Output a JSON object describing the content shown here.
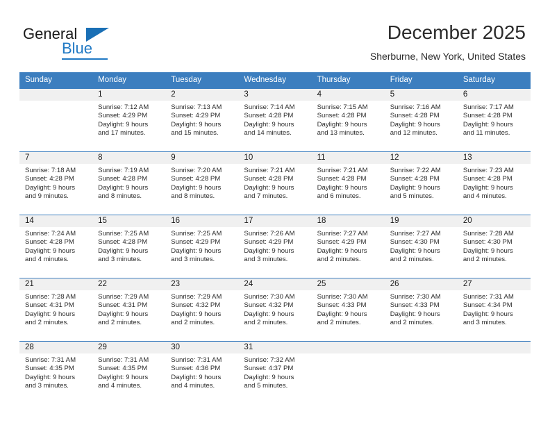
{
  "brand": {
    "name_part1": "General",
    "name_part2": "Blue",
    "triangle_icon": "triangle-icon"
  },
  "header": {
    "month_title": "December 2025",
    "location": "Sherburne, New York, United States"
  },
  "colors": {
    "header_blue": "#3c7ebf",
    "brand_blue": "#2079c4",
    "daynum_band": "#f0f0f0",
    "text": "#2b2b2b"
  },
  "calendar": {
    "weekday_headers": [
      "Sunday",
      "Monday",
      "Tuesday",
      "Wednesday",
      "Thursday",
      "Friday",
      "Saturday"
    ],
    "weeks": [
      [
        {
          "day": "",
          "sunrise": "",
          "sunset": "",
          "daylight_line1": "",
          "daylight_line2": ""
        },
        {
          "day": "1",
          "sunrise": "Sunrise: 7:12 AM",
          "sunset": "Sunset: 4:29 PM",
          "daylight_line1": "Daylight: 9 hours",
          "daylight_line2": "and 17 minutes."
        },
        {
          "day": "2",
          "sunrise": "Sunrise: 7:13 AM",
          "sunset": "Sunset: 4:29 PM",
          "daylight_line1": "Daylight: 9 hours",
          "daylight_line2": "and 15 minutes."
        },
        {
          "day": "3",
          "sunrise": "Sunrise: 7:14 AM",
          "sunset": "Sunset: 4:28 PM",
          "daylight_line1": "Daylight: 9 hours",
          "daylight_line2": "and 14 minutes."
        },
        {
          "day": "4",
          "sunrise": "Sunrise: 7:15 AM",
          "sunset": "Sunset: 4:28 PM",
          "daylight_line1": "Daylight: 9 hours",
          "daylight_line2": "and 13 minutes."
        },
        {
          "day": "5",
          "sunrise": "Sunrise: 7:16 AM",
          "sunset": "Sunset: 4:28 PM",
          "daylight_line1": "Daylight: 9 hours",
          "daylight_line2": "and 12 minutes."
        },
        {
          "day": "6",
          "sunrise": "Sunrise: 7:17 AM",
          "sunset": "Sunset: 4:28 PM",
          "daylight_line1": "Daylight: 9 hours",
          "daylight_line2": "and 11 minutes."
        }
      ],
      [
        {
          "day": "7",
          "sunrise": "Sunrise: 7:18 AM",
          "sunset": "Sunset: 4:28 PM",
          "daylight_line1": "Daylight: 9 hours",
          "daylight_line2": "and 9 minutes."
        },
        {
          "day": "8",
          "sunrise": "Sunrise: 7:19 AM",
          "sunset": "Sunset: 4:28 PM",
          "daylight_line1": "Daylight: 9 hours",
          "daylight_line2": "and 8 minutes."
        },
        {
          "day": "9",
          "sunrise": "Sunrise: 7:20 AM",
          "sunset": "Sunset: 4:28 PM",
          "daylight_line1": "Daylight: 9 hours",
          "daylight_line2": "and 8 minutes."
        },
        {
          "day": "10",
          "sunrise": "Sunrise: 7:21 AM",
          "sunset": "Sunset: 4:28 PM",
          "daylight_line1": "Daylight: 9 hours",
          "daylight_line2": "and 7 minutes."
        },
        {
          "day": "11",
          "sunrise": "Sunrise: 7:21 AM",
          "sunset": "Sunset: 4:28 PM",
          "daylight_line1": "Daylight: 9 hours",
          "daylight_line2": "and 6 minutes."
        },
        {
          "day": "12",
          "sunrise": "Sunrise: 7:22 AM",
          "sunset": "Sunset: 4:28 PM",
          "daylight_line1": "Daylight: 9 hours",
          "daylight_line2": "and 5 minutes."
        },
        {
          "day": "13",
          "sunrise": "Sunrise: 7:23 AM",
          "sunset": "Sunset: 4:28 PM",
          "daylight_line1": "Daylight: 9 hours",
          "daylight_line2": "and 4 minutes."
        }
      ],
      [
        {
          "day": "14",
          "sunrise": "Sunrise: 7:24 AM",
          "sunset": "Sunset: 4:28 PM",
          "daylight_line1": "Daylight: 9 hours",
          "daylight_line2": "and 4 minutes."
        },
        {
          "day": "15",
          "sunrise": "Sunrise: 7:25 AM",
          "sunset": "Sunset: 4:28 PM",
          "daylight_line1": "Daylight: 9 hours",
          "daylight_line2": "and 3 minutes."
        },
        {
          "day": "16",
          "sunrise": "Sunrise: 7:25 AM",
          "sunset": "Sunset: 4:29 PM",
          "daylight_line1": "Daylight: 9 hours",
          "daylight_line2": "and 3 minutes."
        },
        {
          "day": "17",
          "sunrise": "Sunrise: 7:26 AM",
          "sunset": "Sunset: 4:29 PM",
          "daylight_line1": "Daylight: 9 hours",
          "daylight_line2": "and 3 minutes."
        },
        {
          "day": "18",
          "sunrise": "Sunrise: 7:27 AM",
          "sunset": "Sunset: 4:29 PM",
          "daylight_line1": "Daylight: 9 hours",
          "daylight_line2": "and 2 minutes."
        },
        {
          "day": "19",
          "sunrise": "Sunrise: 7:27 AM",
          "sunset": "Sunset: 4:30 PM",
          "daylight_line1": "Daylight: 9 hours",
          "daylight_line2": "and 2 minutes."
        },
        {
          "day": "20",
          "sunrise": "Sunrise: 7:28 AM",
          "sunset": "Sunset: 4:30 PM",
          "daylight_line1": "Daylight: 9 hours",
          "daylight_line2": "and 2 minutes."
        }
      ],
      [
        {
          "day": "21",
          "sunrise": "Sunrise: 7:28 AM",
          "sunset": "Sunset: 4:31 PM",
          "daylight_line1": "Daylight: 9 hours",
          "daylight_line2": "and 2 minutes."
        },
        {
          "day": "22",
          "sunrise": "Sunrise: 7:29 AM",
          "sunset": "Sunset: 4:31 PM",
          "daylight_line1": "Daylight: 9 hours",
          "daylight_line2": "and 2 minutes."
        },
        {
          "day": "23",
          "sunrise": "Sunrise: 7:29 AM",
          "sunset": "Sunset: 4:32 PM",
          "daylight_line1": "Daylight: 9 hours",
          "daylight_line2": "and 2 minutes."
        },
        {
          "day": "24",
          "sunrise": "Sunrise: 7:30 AM",
          "sunset": "Sunset: 4:32 PM",
          "daylight_line1": "Daylight: 9 hours",
          "daylight_line2": "and 2 minutes."
        },
        {
          "day": "25",
          "sunrise": "Sunrise: 7:30 AM",
          "sunset": "Sunset: 4:33 PM",
          "daylight_line1": "Daylight: 9 hours",
          "daylight_line2": "and 2 minutes."
        },
        {
          "day": "26",
          "sunrise": "Sunrise: 7:30 AM",
          "sunset": "Sunset: 4:33 PM",
          "daylight_line1": "Daylight: 9 hours",
          "daylight_line2": "and 2 minutes."
        },
        {
          "day": "27",
          "sunrise": "Sunrise: 7:31 AM",
          "sunset": "Sunset: 4:34 PM",
          "daylight_line1": "Daylight: 9 hours",
          "daylight_line2": "and 3 minutes."
        }
      ],
      [
        {
          "day": "28",
          "sunrise": "Sunrise: 7:31 AM",
          "sunset": "Sunset: 4:35 PM",
          "daylight_line1": "Daylight: 9 hours",
          "daylight_line2": "and 3 minutes."
        },
        {
          "day": "29",
          "sunrise": "Sunrise: 7:31 AM",
          "sunset": "Sunset: 4:35 PM",
          "daylight_line1": "Daylight: 9 hours",
          "daylight_line2": "and 4 minutes."
        },
        {
          "day": "30",
          "sunrise": "Sunrise: 7:31 AM",
          "sunset": "Sunset: 4:36 PM",
          "daylight_line1": "Daylight: 9 hours",
          "daylight_line2": "and 4 minutes."
        },
        {
          "day": "31",
          "sunrise": "Sunrise: 7:32 AM",
          "sunset": "Sunset: 4:37 PM",
          "daylight_line1": "Daylight: 9 hours",
          "daylight_line2": "and 5 minutes."
        },
        {
          "day": "",
          "sunrise": "",
          "sunset": "",
          "daylight_line1": "",
          "daylight_line2": ""
        },
        {
          "day": "",
          "sunrise": "",
          "sunset": "",
          "daylight_line1": "",
          "daylight_line2": ""
        },
        {
          "day": "",
          "sunrise": "",
          "sunset": "",
          "daylight_line1": "",
          "daylight_line2": ""
        }
      ]
    ]
  }
}
